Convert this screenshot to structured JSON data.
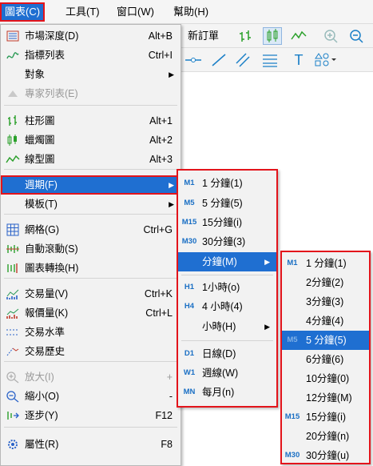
{
  "menubar": {
    "items": [
      "圖表(C)",
      "工具(T)",
      "窗口(W)",
      "幫助(H)"
    ]
  },
  "toolbar": {
    "new_order": "新訂單"
  },
  "main_menu": {
    "items": [
      {
        "icon": "market-depth-icon",
        "label": "市場深度(D)",
        "shortcut": "Alt+B"
      },
      {
        "icon": "indicators-icon",
        "label": "指標列表",
        "shortcut": "Ctrl+I"
      },
      {
        "icon": "",
        "label": "對象",
        "shortcut": "",
        "submenu": true
      },
      {
        "icon": "experts-icon",
        "label": "專家列表(E)",
        "shortcut": "",
        "disabled": true
      },
      {
        "icon": "bar-chart-icon",
        "label": "柱形圖",
        "shortcut": "Alt+1"
      },
      {
        "icon": "candlestick-icon",
        "label": "蠟燭圖",
        "shortcut": "Alt+2"
      },
      {
        "icon": "line-chart-icon",
        "label": "線型圖",
        "shortcut": "Alt+3"
      },
      {
        "icon": "",
        "label": "週期(F)",
        "shortcut": "",
        "submenu": true,
        "highlighted": true
      },
      {
        "icon": "",
        "label": "模板(T)",
        "shortcut": "",
        "submenu": true
      },
      {
        "icon": "grid-icon",
        "label": "網格(G)",
        "shortcut": "Ctrl+G"
      },
      {
        "icon": "autoscroll-icon",
        "label": "自動滾動(S)",
        "shortcut": ""
      },
      {
        "icon": "chart-shift-icon",
        "label": "圖表轉換(H)",
        "shortcut": ""
      },
      {
        "icon": "volume-icon",
        "label": "交易量(V)",
        "shortcut": "Ctrl+K"
      },
      {
        "icon": "tick-volume-icon",
        "label": "報價量(K)",
        "shortcut": "Ctrl+L"
      },
      {
        "icon": "trade-levels-icon",
        "label": "交易水準",
        "shortcut": ""
      },
      {
        "icon": "trade-history-icon",
        "label": "交易歷史",
        "shortcut": ""
      },
      {
        "icon": "zoom-in-icon",
        "label": "放大(I)",
        "shortcut": "+",
        "disabled": true
      },
      {
        "icon": "zoom-out-icon",
        "label": "縮小(O)",
        "shortcut": "-"
      },
      {
        "icon": "step-icon",
        "label": "逐步(Y)",
        "shortcut": "F12"
      },
      {
        "icon": "properties-icon",
        "label": "屬性(R)",
        "shortcut": "F8"
      }
    ]
  },
  "period_menu": {
    "items": [
      {
        "tag": "M1",
        "label": "1 分鐘(1)"
      },
      {
        "tag": "M5",
        "label": "5 分鐘(5)"
      },
      {
        "tag": "M15",
        "label": "15分鐘(i)"
      },
      {
        "tag": "M30",
        "label": "30分鐘(3)"
      },
      {
        "tag": "",
        "label": "分鐘(M)",
        "submenu": true,
        "highlighted": true
      },
      {
        "tag": "H1",
        "label": "1小時(o)"
      },
      {
        "tag": "H4",
        "label": "4 小時(4)"
      },
      {
        "tag": "",
        "label": "小時(H)",
        "submenu": true
      },
      {
        "tag": "D1",
        "label": "日線(D)"
      },
      {
        "tag": "W1",
        "label": "週線(W)"
      },
      {
        "tag": "MN",
        "label": "每月(n)"
      }
    ]
  },
  "minute_menu": {
    "items": [
      {
        "tag": "M1",
        "label": "1 分鐘(1)"
      },
      {
        "tag": "",
        "label": "2分鐘(2)"
      },
      {
        "tag": "",
        "label": "3分鐘(3)"
      },
      {
        "tag": "",
        "label": "4分鐘(4)"
      },
      {
        "tag": "M5",
        "label": "5 分鐘(5)",
        "highlighted": true
      },
      {
        "tag": "",
        "label": "6分鐘(6)"
      },
      {
        "tag": "",
        "label": "10分鐘(0)"
      },
      {
        "tag": "",
        "label": "12分鐘(M)"
      },
      {
        "tag": "M15",
        "label": "15分鐘(i)"
      },
      {
        "tag": "",
        "label": "20分鐘(n)"
      },
      {
        "tag": "M30",
        "label": "30分鐘(u)"
      }
    ]
  },
  "colors": {
    "accent": "#1f6fd1",
    "highlight_border": "#e3141b"
  }
}
